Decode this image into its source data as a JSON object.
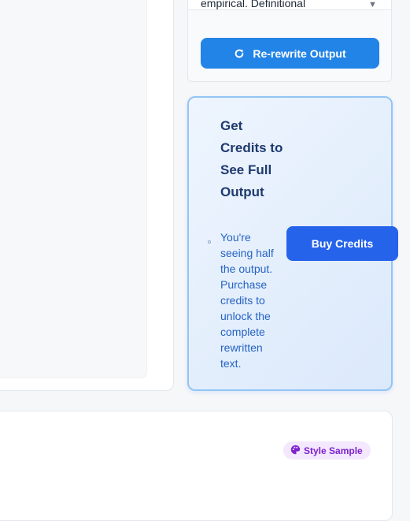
{
  "style_select": {
    "value": "empirical. Definitional"
  },
  "rewrite_button": {
    "label": "Re-rewrite Output"
  },
  "credits_card": {
    "title": "Get Credits to See Full Output",
    "description": "You're seeing half the output. Purchase credits to unlock the complete rewritten text.",
    "button_label": "Buy Credits"
  },
  "style_badge": {
    "label": "Style Sample",
    "icon": "palette-icon"
  },
  "colors": {
    "primary_button": "#2284e6",
    "buy_button": "#2563eb",
    "card_title": "#1e3a6e",
    "card_text": "#2563c4",
    "badge_text": "#7e22ce"
  }
}
